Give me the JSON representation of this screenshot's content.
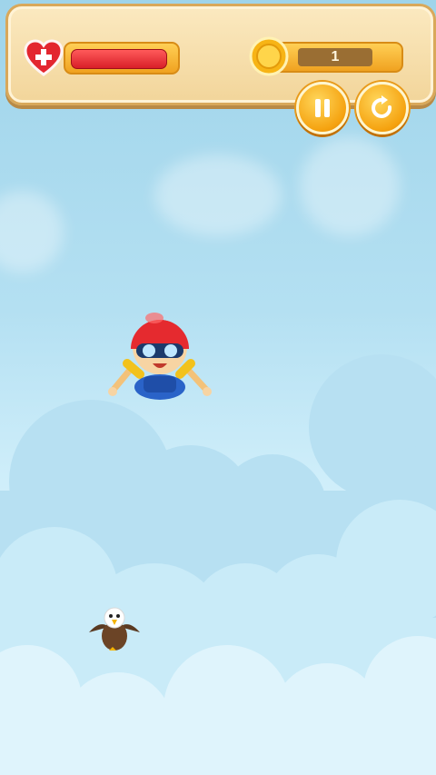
{
  "hud": {
    "health_fraction": 0.93,
    "coin_count": "1",
    "pause_icon": "pause-icon",
    "restart_icon": "restart-icon",
    "heart_icon": "heart-plus-icon",
    "coin_icon": "coin-icon"
  },
  "scene": {
    "player": "skydiver",
    "enemies": [
      "eagle"
    ]
  },
  "colors": {
    "sky_top": "#9fd4ea",
    "sky_bottom": "#dff5fd",
    "health_red": "#e6262f",
    "accent_orange": "#f5a20f",
    "panel_parchment": "#f6dea8"
  }
}
